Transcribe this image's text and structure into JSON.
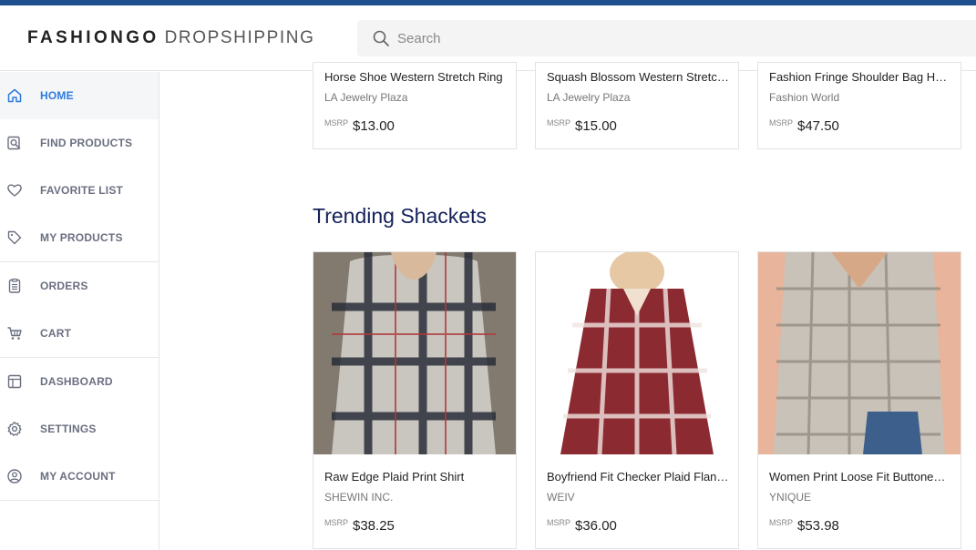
{
  "header": {
    "logo_brand": "FASHIONGO",
    "logo_sub": "DROPSHIPPING",
    "search_placeholder": "Search"
  },
  "sidebar": {
    "items": [
      {
        "label": "HOME",
        "icon": "home-icon",
        "active": true
      },
      {
        "label": "FIND PRODUCTS",
        "icon": "find-products-icon"
      },
      {
        "label": "FAVORITE LIST",
        "icon": "heart-icon"
      },
      {
        "label": "MY PRODUCTS",
        "icon": "tag-icon"
      },
      {
        "label": "ORDERS",
        "icon": "clipboard-icon"
      },
      {
        "label": "CART",
        "icon": "cart-icon"
      },
      {
        "label": "DASHBOARD",
        "icon": "dashboard-icon"
      },
      {
        "label": "SETTINGS",
        "icon": "gear-icon"
      },
      {
        "label": "MY ACCOUNT",
        "icon": "account-icon"
      }
    ]
  },
  "top_products": [
    {
      "name": "Horse Shoe Western Stretch Ring",
      "vendor": "LA Jewelry Plaza",
      "msrp_label": "MSRP",
      "price": "$13.00"
    },
    {
      "name": "Squash Blossom Western Stretch Ring",
      "vendor": "LA Jewelry Plaza",
      "msrp_label": "MSRP",
      "price": "$15.00"
    },
    {
      "name": "Fashion Fringe Shoulder Bag Hobo",
      "vendor": "Fashion World",
      "msrp_label": "MSRP",
      "price": "$47.50"
    }
  ],
  "trending": {
    "title": "Trending Shackets",
    "products": [
      {
        "name": "Raw Edge Plaid Print Shirt",
        "vendor": "SHEWIN INC.",
        "msrp_label": "MSRP",
        "price": "$38.25"
      },
      {
        "name": "Boyfriend Fit Checker Plaid Flannel Shirt",
        "vendor": "WEIV",
        "msrp_label": "MSRP",
        "price": "$36.00"
      },
      {
        "name": "Women Print Loose Fit Buttoned Shacket",
        "vendor": "YNIQUE",
        "msrp_label": "MSRP",
        "price": "$53.98"
      }
    ]
  },
  "colors": {
    "brand_bar": "#1f4e8c",
    "active_nav": "#2d7be0",
    "section_title": "#14215a"
  }
}
